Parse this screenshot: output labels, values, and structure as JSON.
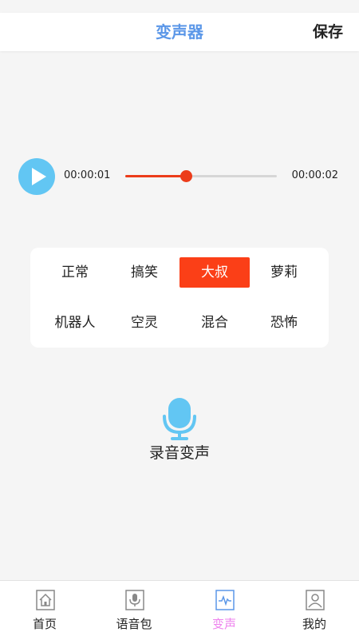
{
  "header": {
    "title": "变声器",
    "save_label": "保存"
  },
  "player": {
    "current_time": "00:00:01",
    "total_time": "00:00:02",
    "progress": 0.4,
    "play_icon": "play-icon"
  },
  "effects": {
    "items": [
      {
        "label": "正常",
        "selected": false
      },
      {
        "label": "搞笑",
        "selected": false
      },
      {
        "label": "大叔",
        "selected": true
      },
      {
        "label": "萝莉",
        "selected": false
      },
      {
        "label": "机器人",
        "selected": false
      },
      {
        "label": "空灵",
        "selected": false
      },
      {
        "label": "混合",
        "selected": false
      },
      {
        "label": "恐怖",
        "selected": false
      }
    ]
  },
  "record": {
    "icon": "microphone-icon",
    "label": "录音变声"
  },
  "tabbar": {
    "tabs": [
      {
        "label": "首页",
        "icon": "home-icon",
        "active": false
      },
      {
        "label": "语音包",
        "icon": "voice-pack-icon",
        "active": false
      },
      {
        "label": "变声",
        "icon": "voice-change-icon",
        "active": true
      },
      {
        "label": "我的",
        "icon": "profile-icon",
        "active": false
      }
    ]
  },
  "colors": {
    "title_blue": "#5b97e8",
    "accent_red": "#fb3f17",
    "play_blue": "#62c6f3",
    "active_tab": "#ee82ee"
  }
}
